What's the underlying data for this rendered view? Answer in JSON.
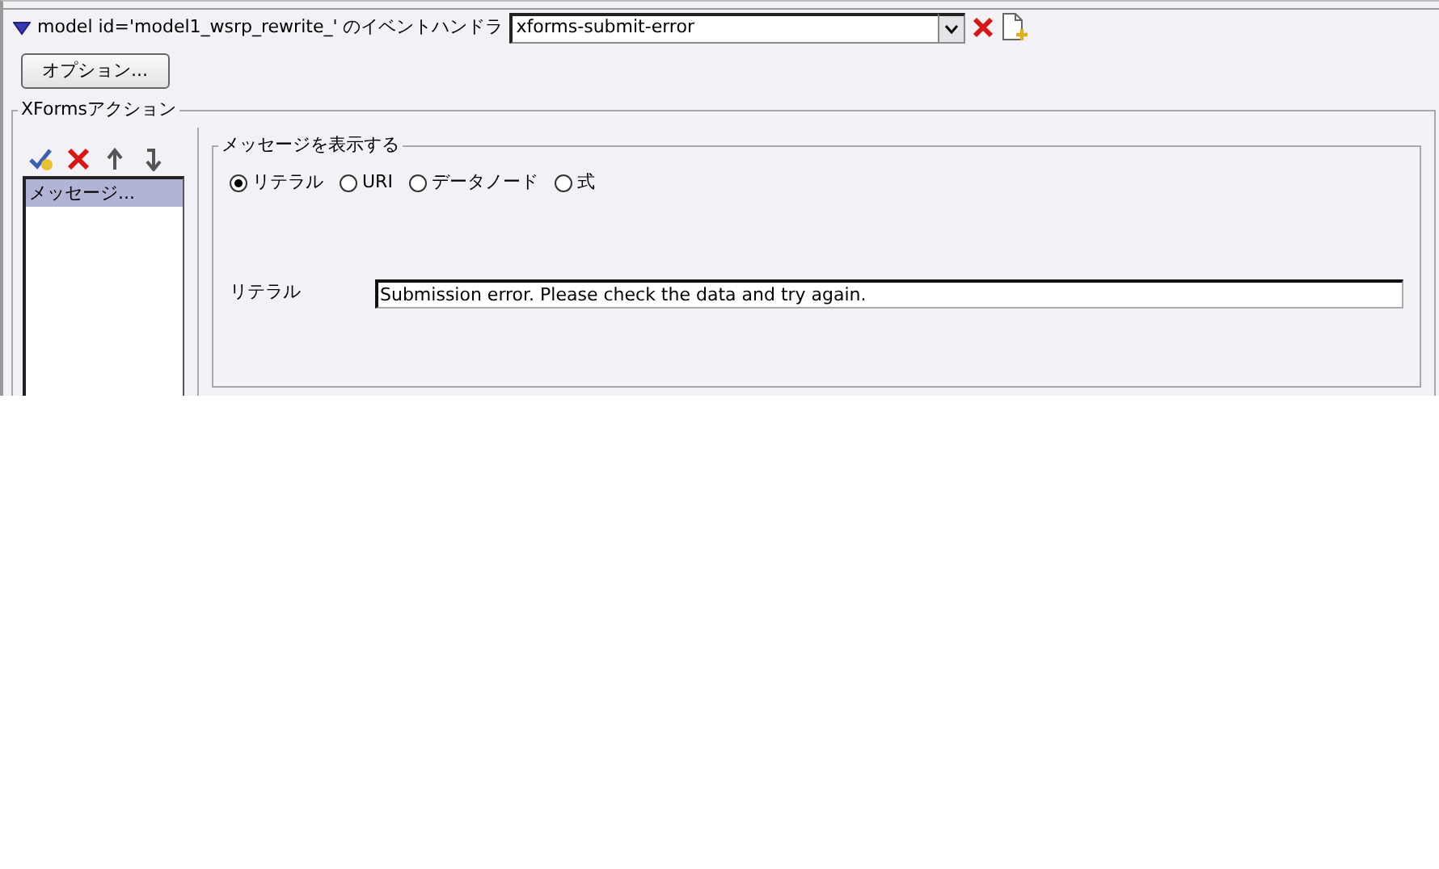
{
  "handler": {
    "expanded": true,
    "label": "model id='model1_wsrp_rewrite_' のイベントハンドラ",
    "event_value": "xforms-submit-error"
  },
  "options_button": "オプション...",
  "actions": {
    "title": "XFormsアクション",
    "items": [
      {
        "label": "メッセージ...",
        "selected": true
      }
    ],
    "detail": {
      "title": "メッセージを表示する",
      "radios": [
        {
          "label": "リテラル",
          "selected": true
        },
        {
          "label": "URI",
          "selected": false
        },
        {
          "label": "データノード",
          "selected": false
        },
        {
          "label": "式",
          "selected": false
        }
      ],
      "field": {
        "label": "リテラル",
        "value": "Submission error. Please check the data and try again."
      }
    }
  }
}
